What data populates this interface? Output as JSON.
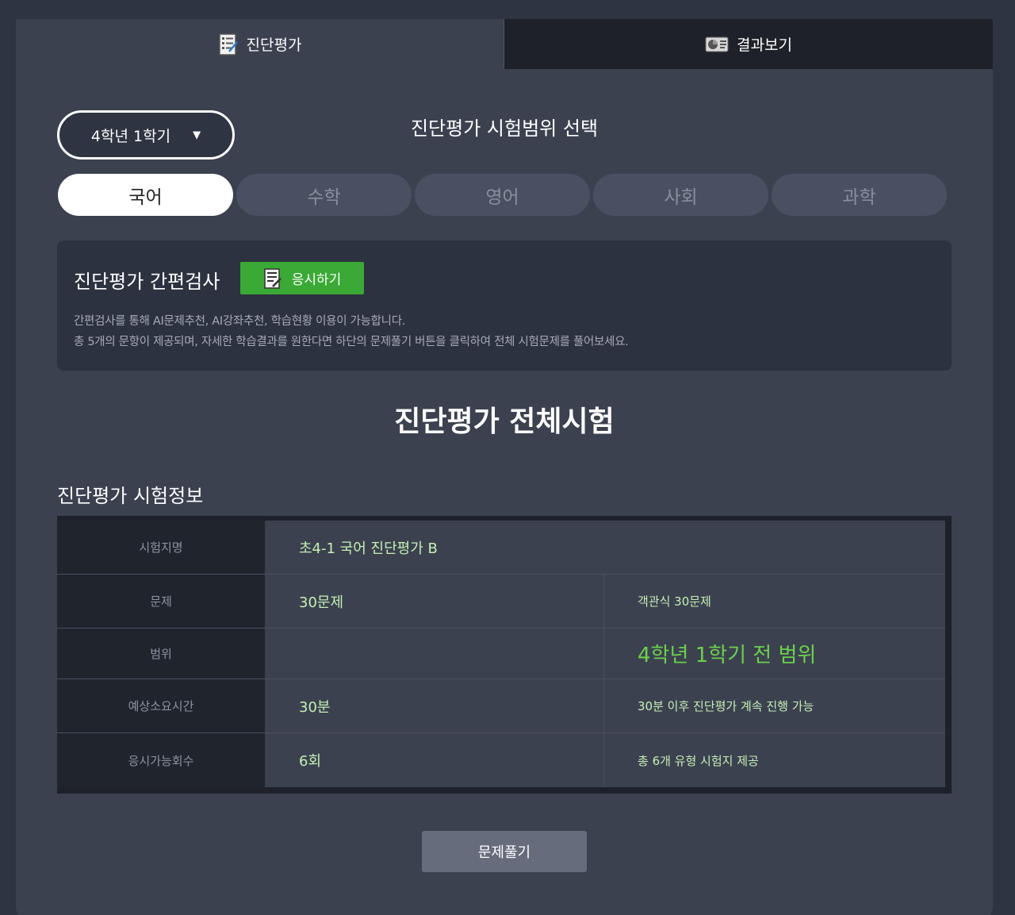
{
  "tabs": [
    {
      "label": "진단평가",
      "icon": "checklist-icon",
      "active": true
    },
    {
      "label": "결과보기",
      "icon": "chart-icon",
      "active": false
    }
  ],
  "grade_select": {
    "value": "4학년 1학기"
  },
  "range_title": "진단평가 시험범위 선택",
  "subjects": [
    {
      "label": "국어",
      "active": true
    },
    {
      "label": "수학",
      "active": false
    },
    {
      "label": "영어",
      "active": false
    },
    {
      "label": "사회",
      "active": false
    },
    {
      "label": "과학",
      "active": false
    }
  ],
  "quick": {
    "title": "진단평가 간편검사",
    "button": "응시하기",
    "desc_line1": "간편검사를 통해 AI문제추천, AI강좌추천, 학습현황 이용이 가능합니다.",
    "desc_line2": "총 5개의 문항이 제공되며, 자세한 학습결과를 원한다면 하단의 문제풀기 버튼을 클릭하여 전체 시험문제를 풀어보세요."
  },
  "full_title": "진단평가 전체시험",
  "info_title": "진단평가 시험정보",
  "info": {
    "exam_name_label": "시험지명",
    "exam_name": "초4-1 국어 진단평가 B",
    "questions_label": "문제",
    "questions": "30문제",
    "questions_note": "객관식 30문제",
    "range_label": "범위",
    "range_value": "",
    "range_note": "4학년 1학기 전 범위",
    "time_label": "예상소요시간",
    "time": "30분",
    "time_note": "30분 이후 진단평가 계속 진행 가능",
    "attempts_label": "응시가능회수",
    "attempts": "6회",
    "attempts_note": "총 6개 유형 시험지 제공"
  },
  "solve_button": "문제풀기",
  "colors": {
    "accent_green": "#3aa935",
    "highlight_green": "#6cd04a",
    "value_green": "#c4f0b4"
  }
}
